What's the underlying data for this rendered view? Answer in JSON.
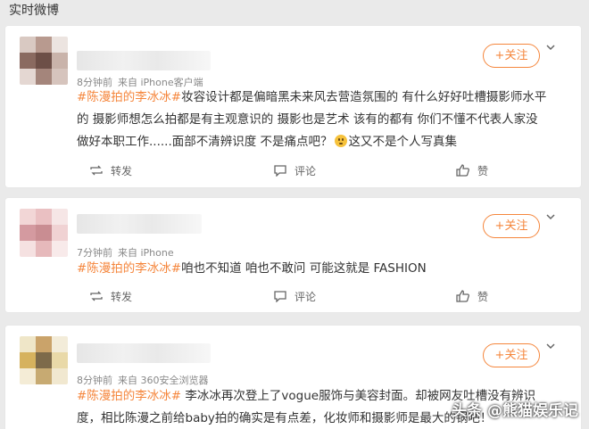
{
  "section_title": "实时微博",
  "follow_label": "+关注",
  "actions": {
    "repost": "转发",
    "comment": "评论",
    "like": "赞"
  },
  "colors": {
    "accent": "#f5863c",
    "background": "#eaeaea",
    "card": "#ffffff"
  },
  "posts": [
    {
      "time": "8分钟前",
      "source": "来自 iPhone客户端",
      "hashtag": "#陈漫拍的李冰冰#",
      "line1_rest": "妆容设计都是偏暗黑未来风去营造氛围的 有什么好好吐槽摄影师水平",
      "line2": "的 摄影师想怎么拍都是有主观意识的 摄影也是艺术 该有的都有 你们不懂不代表人家没",
      "line3_a": "做好本职工作......面部不清辨识度 不是痛点吧？",
      "line3_emoji": "thinking-face",
      "line3_b": "这又不是个人写真集"
    },
    {
      "time": "7分钟前",
      "source": "来自 iPhone",
      "hashtag": "#陈漫拍的李冰冰#",
      "line1_rest": "咱也不知道 咱也不敢问 可能这就是 FASHION"
    },
    {
      "time": "8分钟前",
      "source": "来自 360安全浏览器",
      "hashtag": "#陈漫拍的李冰冰#",
      "line1_rest": " 李冰冰再次登上了vogue服饰与美容封面。却被网友吐槽没有辨识",
      "line2": "度，相比陈漫之前给baby拍的确实是有点差，化妆师和摄影师是最大的锅吧！"
    }
  ],
  "watermark": "头条 @熊猫娱乐记"
}
